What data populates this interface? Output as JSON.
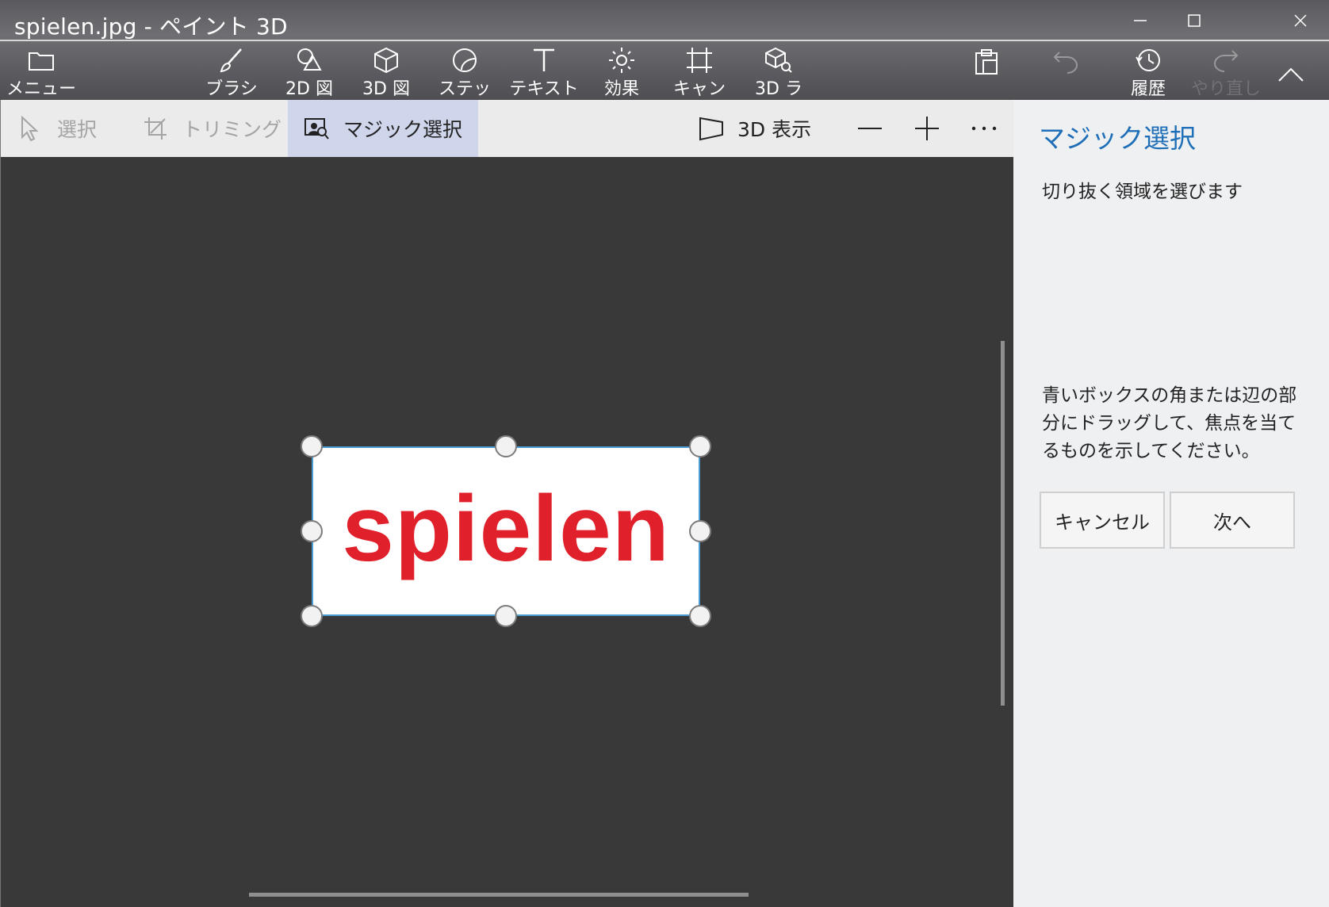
{
  "window": {
    "title": "spielen.jpg - ペイント 3D"
  },
  "toolbar": {
    "menu": "メニュー",
    "brush": "ブラシ",
    "shapes2d": "2D 図",
    "shapes3d": "3D 図",
    "stickers": "ステッ",
    "text": "テキスト",
    "effects": "効果",
    "canvas": "キャン",
    "library3d": "3D ラ",
    "history": "履歴",
    "redo": "やり直し"
  },
  "subtoolbar": {
    "select": "選択",
    "crop": "トリミング",
    "magic_select": "マジック選択",
    "view3d": "3D 表示"
  },
  "canvas": {
    "image_text": "spielen"
  },
  "panel": {
    "title": "マジック選択",
    "subtitle": "切り抜く領域を選びます",
    "help": "青いボックスの角または辺の部分にドラッグして、焦点を当てるものを示してください。",
    "cancel": "キャンセル",
    "next": "次へ"
  },
  "colors": {
    "accent_blue": "#1e6fb8",
    "selection_border": "#4a9bd1",
    "image_text_red": "#e0212b",
    "active_tab_bg": "#cfd6ec"
  },
  "icons": [
    "folder-icon",
    "brush-icon",
    "shapes-2d-icon",
    "cube-icon",
    "sticker-icon",
    "text-icon",
    "effects-icon",
    "canvas-icon",
    "library-3d-icon",
    "paste-icon",
    "undo-icon",
    "history-icon",
    "redo-icon",
    "collapse-icon",
    "cursor-icon",
    "crop-icon",
    "magic-select-icon",
    "view-3d-icon",
    "zoom-out-icon",
    "zoom-in-icon",
    "more-icon"
  ]
}
